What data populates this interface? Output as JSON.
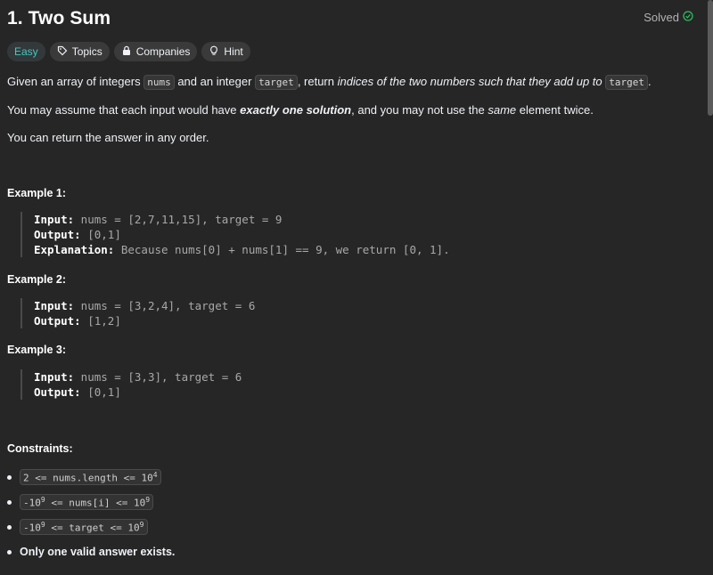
{
  "problem": {
    "title": "1. Two Sum",
    "status": "Solved"
  },
  "chips": {
    "difficulty": "Easy",
    "topics": "Topics",
    "companies": "Companies",
    "hint": "Hint"
  },
  "description": {
    "p1_a": "Given an array of integers ",
    "p1_code1": "nums",
    "p1_b": " and an integer ",
    "p1_code2": "target",
    "p1_c": ", return ",
    "p1_em": "indices of the two numbers such that they add up to",
    "p1_d": " ",
    "p1_code3": "target",
    "p1_e": ".",
    "p2_a": "You may assume that each input would have ",
    "p2_strong": "exactly one solution",
    "p2_b": ", and you may not use the ",
    "p2_em": "same",
    "p2_c": " element twice.",
    "p3": "You can return the answer in any order."
  },
  "examples": [
    {
      "heading": "Example 1:",
      "input_label": "Input:",
      "input": " nums = [2,7,11,15], target = 9",
      "output_label": "Output:",
      "output": " [0,1]",
      "explanation_label": "Explanation:",
      "explanation": " Because nums[0] + nums[1] == 9, we return [0, 1]."
    },
    {
      "heading": "Example 2:",
      "input_label": "Input:",
      "input": " nums = [3,2,4], target = 6",
      "output_label": "Output:",
      "output": " [1,2]"
    },
    {
      "heading": "Example 3:",
      "input_label": "Input:",
      "input": " nums = [3,3], target = 6",
      "output_label": "Output:",
      "output": " [0,1]"
    }
  ],
  "constraints": {
    "heading": "Constraints:",
    "c1_a": "2 <= nums.length <= 10",
    "c1_sup": "4",
    "c2_a": "-10",
    "c2_sup1": "9",
    "c2_b": " <= nums[i] <= 10",
    "c2_sup2": "9",
    "c3_a": "-10",
    "c3_sup1": "9",
    "c3_b": " <= target <= 10",
    "c3_sup2": "9",
    "c4": "Only one valid answer exists."
  },
  "colors": {
    "background": "#262626",
    "easy": "#46c6c2",
    "solved_check": "#2cbb5d"
  }
}
